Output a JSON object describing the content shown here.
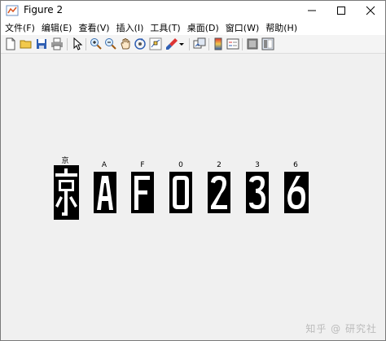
{
  "window": {
    "title": "Figure 2"
  },
  "menu": [
    "文件(F)",
    "编辑(E)",
    "查看(V)",
    "插入(I)",
    "工具(T)",
    "桌面(D)",
    "窗口(W)",
    "帮助(H)"
  ],
  "toolbar": {
    "icons": [
      "new-figure-icon",
      "open-file-icon",
      "save-icon",
      "print-icon",
      "pointer-icon",
      "zoom-in-icon",
      "zoom-out-icon",
      "pan-icon",
      "rotate-3d-icon",
      "data-cursor-icon",
      "brush-icon",
      "brush-dropdown-icon",
      "link-plot-icon",
      "insert-colorbar-icon",
      "insert-legend-icon",
      "hide-plot-tools-icon",
      "show-plot-tools-icon"
    ]
  },
  "figure": {
    "characters": [
      {
        "label": "京"
      },
      {
        "label": "A"
      },
      {
        "label": "F"
      },
      {
        "label": "0"
      },
      {
        "label": "2"
      },
      {
        "label": "3"
      },
      {
        "label": "6"
      }
    ]
  },
  "watermark": "知乎 @ 研究社"
}
